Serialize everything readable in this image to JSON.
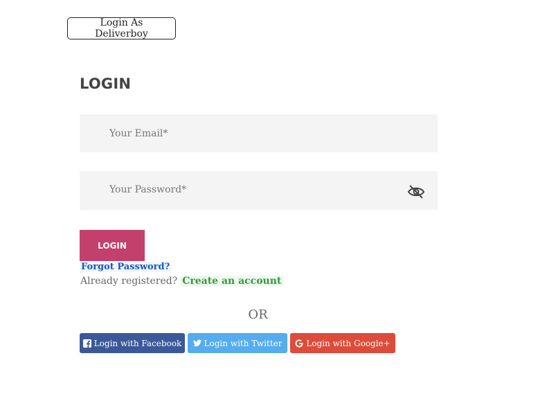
{
  "header": {
    "deliverboy_button": "Login As Deliverboy"
  },
  "login": {
    "title": "LOGIN",
    "email_placeholder": "Your Email*",
    "password_placeholder": "Your Password*",
    "submit_label": "LOGIN",
    "forgot_password": "Forgot Password?",
    "already_registered": "Already registered?",
    "create_account": "Create an account"
  },
  "divider": {
    "or": "OR"
  },
  "social": {
    "facebook": "Login with Facebook",
    "twitter": "Login with Twitter",
    "google": "Login with Google+"
  },
  "colors": {
    "login_button": "#c2406b",
    "facebook": "#3b5998",
    "twitter": "#55acee",
    "google": "#dd4b39",
    "forgot_link": "#1a56b8",
    "create_link": "#2e9e3a"
  },
  "icons": {
    "password_toggle": "eye-slash-icon",
    "facebook": "facebook-icon",
    "twitter": "twitter-icon",
    "google": "google-icon"
  }
}
